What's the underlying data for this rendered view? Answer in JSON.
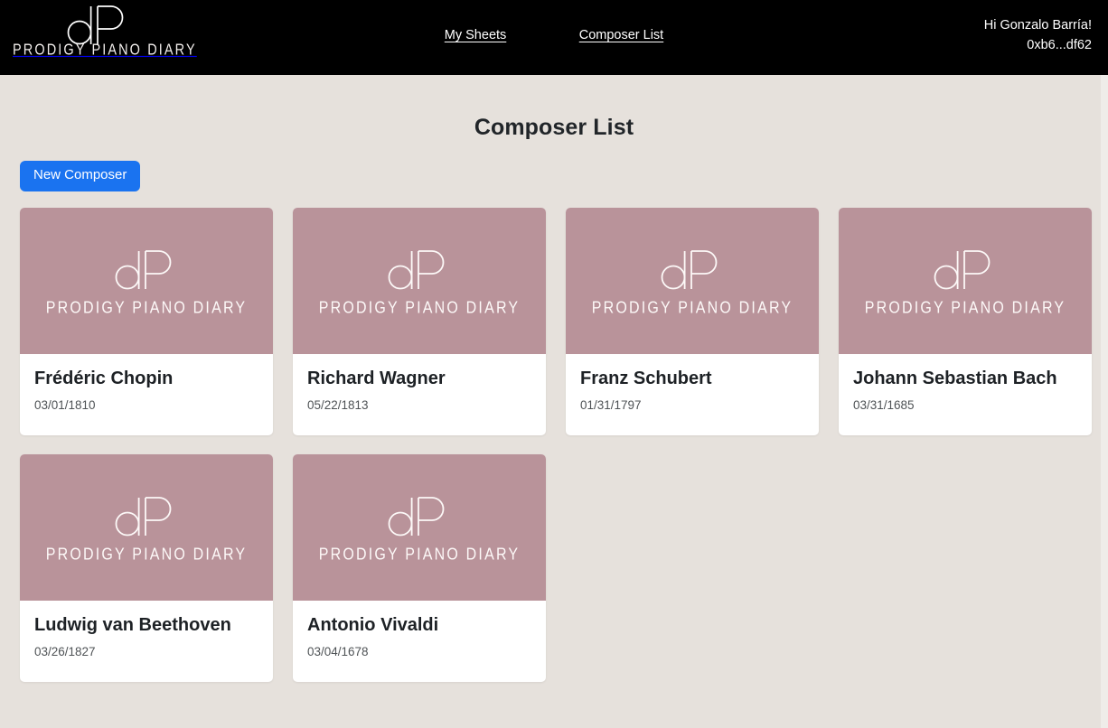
{
  "navbar": {
    "brand": {
      "monogram": "dP",
      "wordmark": "PRODIGY PIANO DIARY"
    },
    "links": [
      {
        "label": "My Sheets"
      },
      {
        "label": "Composer List"
      }
    ],
    "user": {
      "greeting": "Hi Gonzalo Barría!",
      "wallet": "0xb6...df62"
    }
  },
  "main": {
    "title": "Composer List",
    "new_composer_label": "New Composer",
    "card_image": {
      "monogram": "dP",
      "wordmark": "PRODIGY PIANO DIARY"
    },
    "composers": [
      {
        "name": "Frédéric Chopin",
        "date": "03/01/1810"
      },
      {
        "name": "Richard Wagner",
        "date": "05/22/1813"
      },
      {
        "name": "Franz Schubert",
        "date": "01/31/1797"
      },
      {
        "name": "Johann Sebastian Bach",
        "date": "03/31/1685"
      },
      {
        "name": "Ludwig van Beethoven",
        "date": "03/26/1827"
      },
      {
        "name": "Antonio Vivaldi",
        "date": "03/04/1678"
      }
    ]
  },
  "colors": {
    "navbar_bg": "#000000",
    "page_bg": "#e6e1dc",
    "card_bg": "#ffffff",
    "card_image_bg": "#b9939a",
    "button_primary": "#1a73f0",
    "title_text": "#212529",
    "date_text": "#4f5356"
  }
}
